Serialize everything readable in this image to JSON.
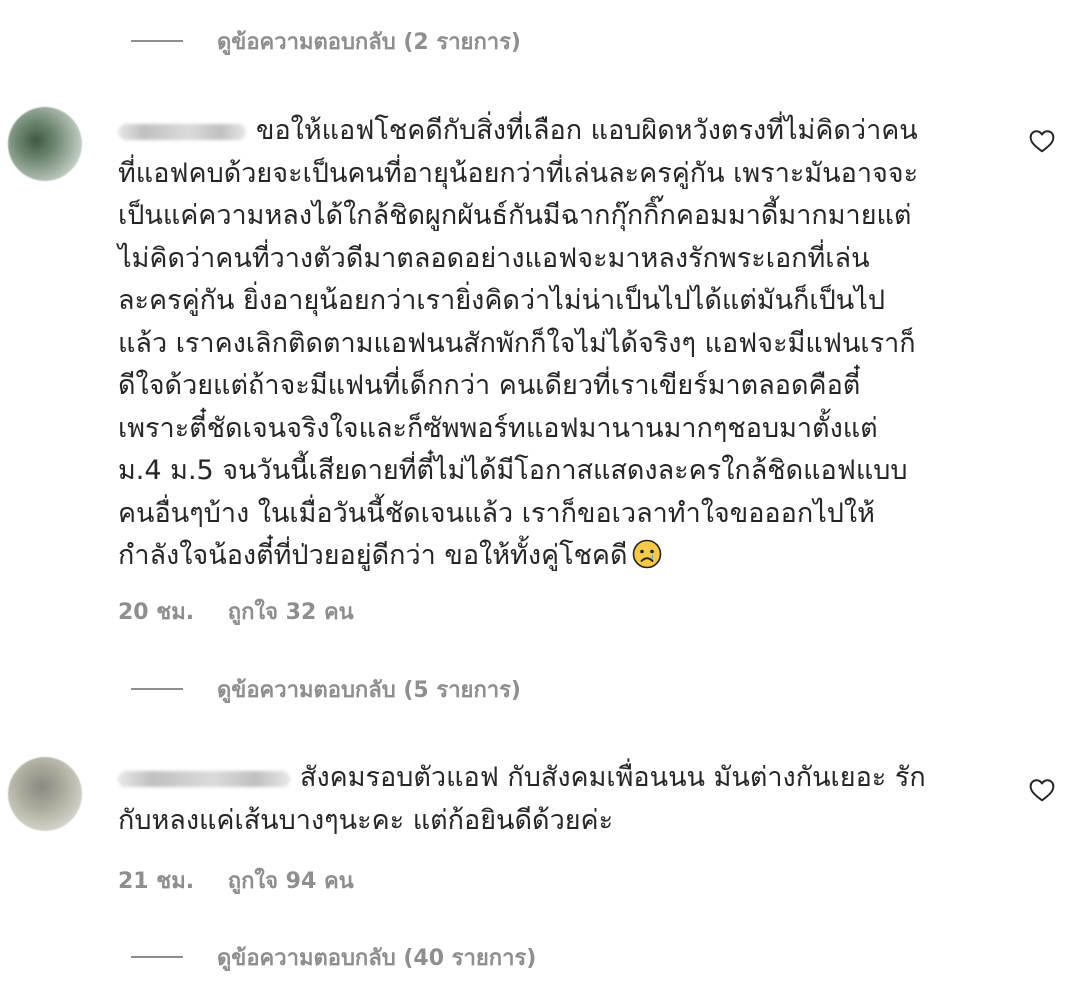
{
  "view_replies_1": "ดูข้อความตอบกลับ (2 รายการ)",
  "comments": [
    {
      "lines": [
        "ขอให้แอฟโชคดีกับสิ่งที่เลือก แอบผิดหวังตรงที่ไม่คิดว่าคน",
        "ที่แอฟคบด้วยจะเป็นคนที่อายุน้อยกว่าที่เล่นละครคู่กัน เพราะมันอาจจะ",
        "เป็นแค่ความหลงได้ใกล้ชิดผูกผันธ์กันมีฉากกุ๊กกิ๊กคอมมาดี้มากมายแต่",
        "ไม่คิดว่าคนที่วางตัวดีมาตลอดอย่างแอฟจะมาหลงรักพระเอกที่เล่น",
        "ละครคู่กัน ยิ่งอายุน้อยกว่าเรายิ่งคิดว่าไม่น่าเป็นไปได้แต่มันก็เป็นไป",
        "แล้ว เราคงเลิกติดตามแอฟนนสักพักก็ใจไม่ได้จริงๆ แอฟจะมีแฟนเราก็",
        "ดีใจด้วยแต่ถ้าจะมีแฟนที่เด็กกว่า คนเดียวที่เราเขียร์มาตลอดคือตี๋",
        "เพราะตี๋ชัดเจนจริงใจและก็ซัพพอร์ทแอฟมานานมากๆชอบมาตั้งแต่",
        "ม.4 ม.5 จนวันนี้เสียดายที่ตี๋ไม่ได้มีโอกาสแสดงละครใกล้ชิดแอฟแบบ",
        "คนอื่นๆบ้าง ในเมื่อวันนี้ชัดเจนแล้ว เราก็ขอเวลาทำใจขอออกไปให้",
        "กำลังใจน้องตี๋ที่ป่วยอยู่ดีกว่า ขอให้ทั้งคู่โชคดี"
      ],
      "emoji": "crying-face",
      "time": "20 ชม.",
      "likes": "ถูกใจ 32 คน",
      "view_replies": "ดูข้อความตอบกลับ (5 รายการ)"
    },
    {
      "lines": [
        "สังคมรอบตัวแอฟ กับสังคมเพื่อนนน มันต่างกันเยอะ รัก",
        "กับหลงแค่เส้นบางๆนะคะ แต่ก้อยินดีด้วยค่ะ"
      ],
      "time": "21 ชม.",
      "likes": "ถูกใจ 94 คน",
      "view_replies": "ดูข้อความตอบกลับ (40 รายการ)"
    }
  ],
  "icons": {
    "like": "heart-outline-icon",
    "emoji": "sad-face-icon"
  },
  "colors": {
    "text": "#262626",
    "secondary": "#8e8e8e"
  }
}
